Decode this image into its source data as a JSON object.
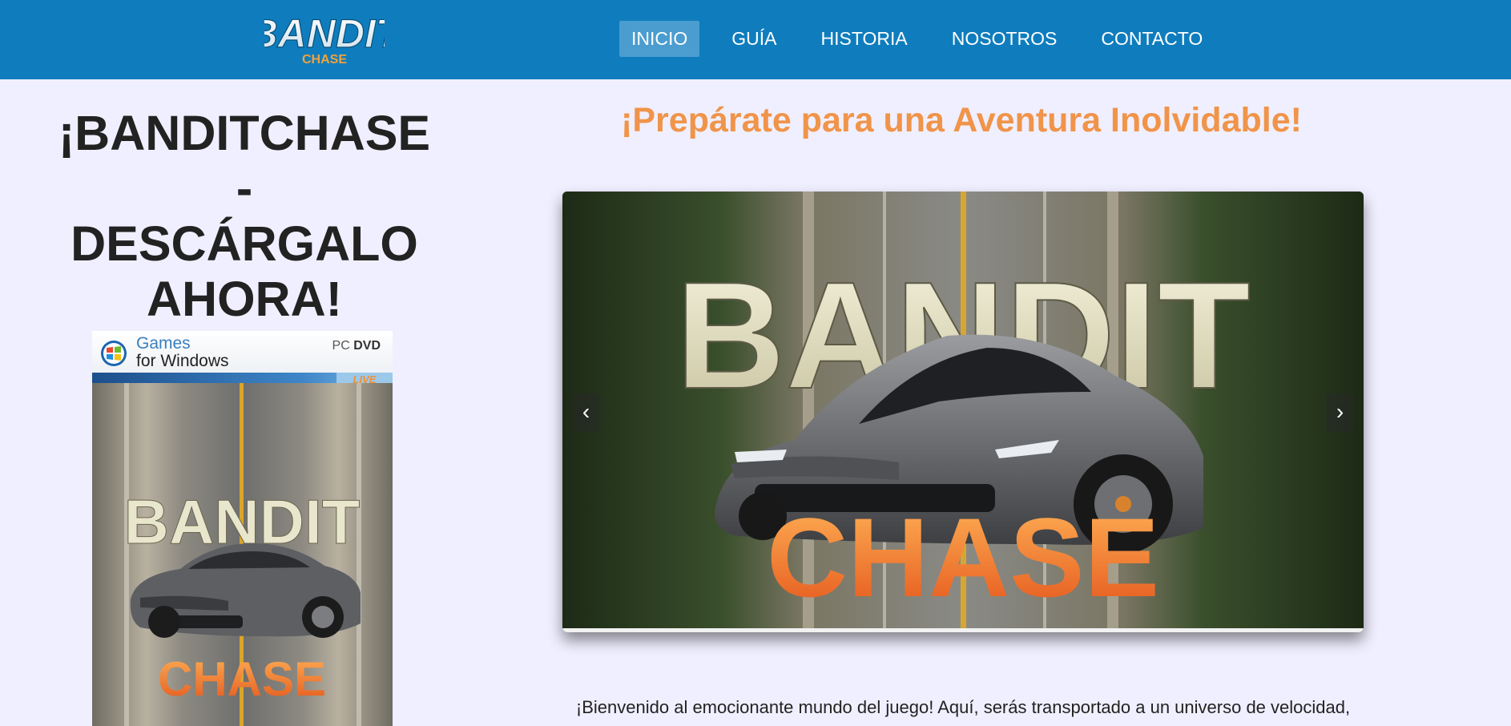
{
  "header": {
    "logo": {
      "line1": "BANDIT",
      "line2": "CHASE"
    },
    "nav": [
      {
        "label": "INICIO",
        "active": true
      },
      {
        "label": "GUÍA",
        "active": false
      },
      {
        "label": "HISTORIA",
        "active": false
      },
      {
        "label": "NOSOTROS",
        "active": false
      },
      {
        "label": "CONTACTO",
        "active": false
      }
    ]
  },
  "sidebar": {
    "title_lines": [
      "¡BANDITCHASE",
      "-",
      "DESCÁRGALO",
      "AHORA!"
    ],
    "cover": {
      "brand_line1": "Games",
      "brand_line2": "for Windows",
      "format_prefix": "PC",
      "format": "DVD",
      "badge": "LIVE",
      "art_title": "BANDIT",
      "art_subtitle": "CHASE"
    }
  },
  "main": {
    "headline": "¡Prepárate para una Aventura Inolvidable!",
    "carousel": {
      "slide_title": "BANDIT",
      "slide_subtitle": "CHASE",
      "prev_label": "‹",
      "next_label": "›"
    },
    "intro_text": "¡Bienvenido al emocionante mundo del juego! Aquí, serás transportado a un universo de velocidad,"
  },
  "colors": {
    "navbar": "#0f7dbd",
    "nav_active": "#4b9dd0",
    "page_bg": "#f0efff",
    "headline": "#f0944a",
    "title_text": "#222222"
  },
  "icons": {
    "windows_logo": "windows-flag-icon",
    "prev": "chevron-left-icon",
    "next": "chevron-right-icon"
  }
}
